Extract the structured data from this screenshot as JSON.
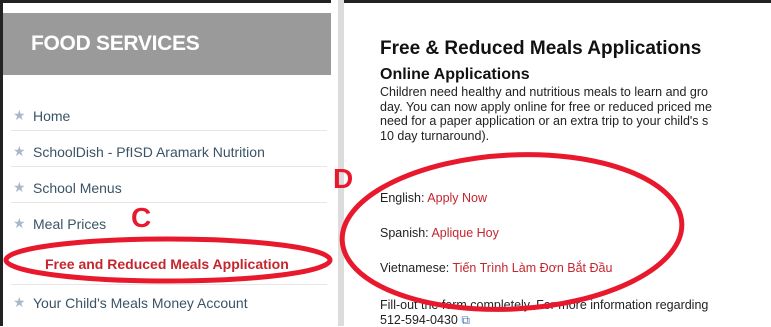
{
  "sidebar": {
    "header": "FOOD SERVICES",
    "items": [
      {
        "label": "Home"
      },
      {
        "label": "SchoolDish - PfISD Aramark Nutrition"
      },
      {
        "label": "School Menus"
      },
      {
        "label": "Meal Prices"
      },
      {
        "label": "Free and Reduced Meals Application"
      },
      {
        "label": "Your Child's Meals Money Account"
      }
    ]
  },
  "main": {
    "title": "Free & Reduced Meals Applications",
    "subtitle": "Online Applications",
    "paragraph_lines": [
      "Children need healthy and nutritious meals to learn and gro",
      "day. You can now apply online for free or reduced priced me",
      "need for a paper application or an extra trip to your child's s",
      "10 day turnaround)."
    ],
    "languages": [
      {
        "label": "English:",
        "link": "Apply Now"
      },
      {
        "label": "Spanish:",
        "link": "Aplique Hoy"
      },
      {
        "label": "Vietnamese:",
        "link": "Tiến Trình Làm Đơn Bắt Đầu"
      }
    ],
    "footer_lines": [
      "Fill-out the form completely. For more information regarding",
      "512-594-0430"
    ]
  },
  "annotations": {
    "c_label": "C",
    "d_label": "D",
    "color": "#e8192c"
  },
  "icons": {
    "star": "★",
    "external": "⧉"
  }
}
